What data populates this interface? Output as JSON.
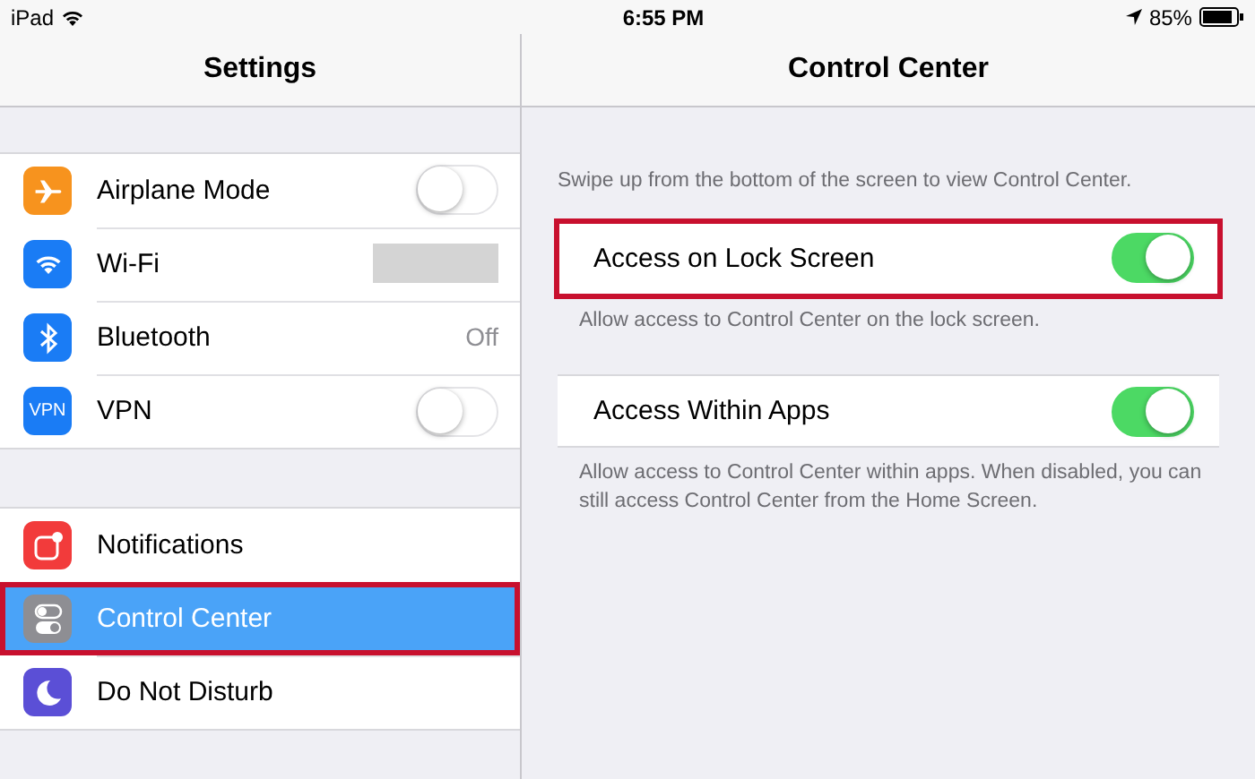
{
  "status_bar": {
    "device": "iPad",
    "time": "6:55 PM",
    "battery": "85%"
  },
  "sidebar": {
    "title": "Settings",
    "groups": [
      {
        "items": [
          {
            "label": "Airplane Mode",
            "kind": "toggle",
            "on": false,
            "color": "#f7931e",
            "selected": false,
            "highlighted": false
          },
          {
            "label": "Wi-Fi",
            "kind": "hidden",
            "color": "#1a7cf5",
            "selected": false,
            "highlighted": false
          },
          {
            "label": "Bluetooth",
            "kind": "value",
            "value": "Off",
            "color": "#1a7cf5",
            "selected": false,
            "highlighted": false
          },
          {
            "label": "VPN",
            "kind": "toggle",
            "on": false,
            "color": "#1a7cf5",
            "icon_text": "VPN",
            "selected": false,
            "highlighted": false
          }
        ]
      },
      {
        "items": [
          {
            "label": "Notifications",
            "kind": "link",
            "color": "#f23b3b",
            "selected": false,
            "highlighted": false
          },
          {
            "label": "Control Center",
            "kind": "link",
            "color": "#8e8e93",
            "selected": true,
            "highlighted": true
          },
          {
            "label": "Do Not Disturb",
            "kind": "link",
            "color": "#5b4fd6",
            "selected": false,
            "highlighted": false
          }
        ]
      }
    ]
  },
  "detail": {
    "title": "Control Center",
    "intro": "Swipe up from the bottom of the screen to view Control Center.",
    "settings": [
      {
        "label": "Access on Lock Screen",
        "on": true,
        "highlighted": true,
        "footer": "Allow access to Control Center on the lock screen."
      },
      {
        "label": "Access Within Apps",
        "on": true,
        "highlighted": false,
        "footer": "Allow access to Control Center within apps. When disabled, you can still access Control Center from the Home Screen."
      }
    ]
  }
}
